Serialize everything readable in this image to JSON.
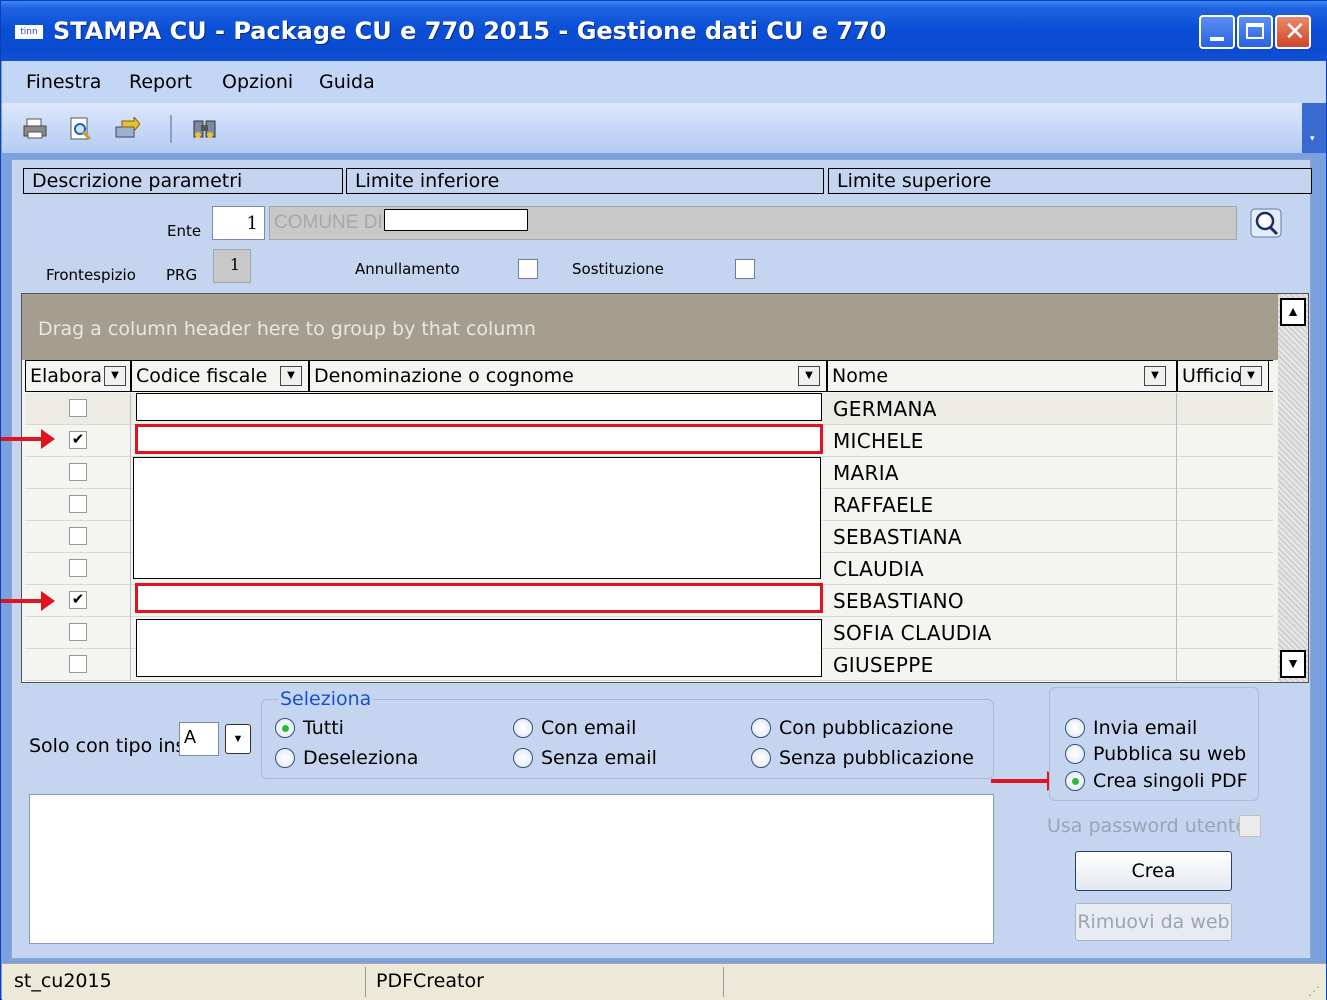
{
  "window": {
    "app_icon_text": "tinn",
    "title": "STAMPA CU - Package CU e 770 2015 - Gestione dati CU e 770"
  },
  "menu": [
    "Finestra",
    "Report",
    "Opzioni",
    "Guida"
  ],
  "toolbar": {
    "icons": [
      "print-icon",
      "print-preview-icon",
      "export-icon",
      "binoculars-icon"
    ]
  },
  "params": {
    "headers": [
      "Descrizione parametri",
      "Limite inferiore",
      "Limite superiore"
    ],
    "ente_label": "Ente",
    "ente_value": "1",
    "ente_desc": "COMUNE DI",
    "frontespizio_label": "Frontespizio",
    "prg_label": "PRG",
    "prg_value": "1",
    "annullamento_label": "Annullamento",
    "sostituzione_label": "Sostituzione"
  },
  "grid": {
    "group_hint": "Drag a column header here to group by that column",
    "columns": [
      "Elabora",
      "Codice fiscale",
      "Denominazione o cognome",
      "Nome",
      "Ufficio"
    ],
    "rows": [
      {
        "checked": false,
        "nome": "GERMANA"
      },
      {
        "checked": true,
        "nome": "MICHELE"
      },
      {
        "checked": false,
        "nome": "MARIA"
      },
      {
        "checked": false,
        "nome": "RAFFAELE"
      },
      {
        "checked": false,
        "nome": "SEBASTIANA"
      },
      {
        "checked": false,
        "nome": "CLAUDIA"
      },
      {
        "checked": true,
        "nome": "SEBASTIANO"
      },
      {
        "checked": false,
        "nome": "SOFIA CLAUDIA"
      },
      {
        "checked": false,
        "nome": "GIUSEPPE"
      }
    ]
  },
  "bottom": {
    "solo_label": "Solo con tipo ins.",
    "solo_value": "A",
    "seleziona_title": "Seleziona",
    "sel_options": [
      "Tutti",
      "Deseleziona",
      "Con email",
      "Senza email",
      "Con pubblicazione",
      "Senza pubblicazione"
    ],
    "sel_selected": "Tutti",
    "action_options": [
      "Invia email",
      "Pubblica su web",
      "Crea singoli PDF"
    ],
    "action_selected": "Crea singoli PDF",
    "usa_password_label": "Usa password utente",
    "crea_button": "Crea",
    "rimuovi_button": "Rimuovi da web"
  },
  "status": [
    "st_cu2015",
    "PDFCreator"
  ],
  "colors": {
    "highlight": "#e0141e",
    "title_bar": "#0b4fd6"
  }
}
